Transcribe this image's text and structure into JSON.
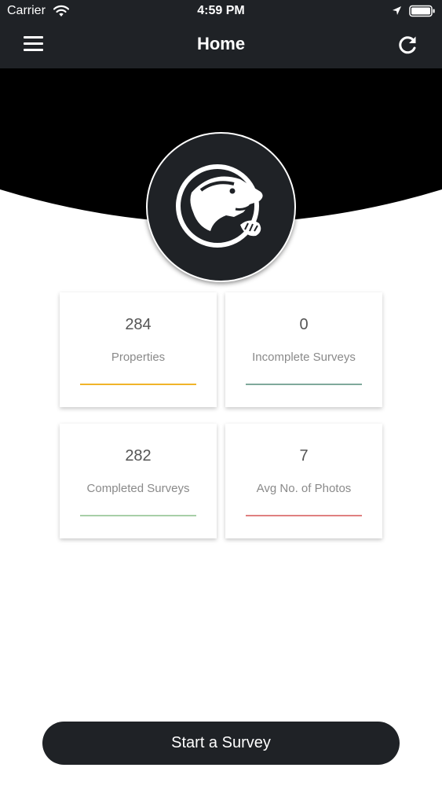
{
  "status_bar": {
    "carrier": "Carrier",
    "time": "4:59 PM"
  },
  "nav": {
    "title": "Home",
    "menu_icon": "hamburger-menu-icon",
    "refresh_icon": "refresh-icon"
  },
  "logo": {
    "icon": "bear-logo-icon"
  },
  "stats": [
    {
      "value": "284",
      "label": "Properties",
      "accent": "#f0b429"
    },
    {
      "value": "0",
      "label": "Incomplete Surveys",
      "accent": "#7fa99b"
    },
    {
      "value": "282",
      "label": "Completed Surveys",
      "accent": "#a8cfa8"
    },
    {
      "value": "7",
      "label": "Avg No. of Photos",
      "accent": "#e08080"
    }
  ],
  "actions": {
    "start_survey": "Start a Survey"
  },
  "colors": {
    "header_bg": "#1f2226",
    "hero_bg": "#000000",
    "button_bg": "#1f2226"
  }
}
